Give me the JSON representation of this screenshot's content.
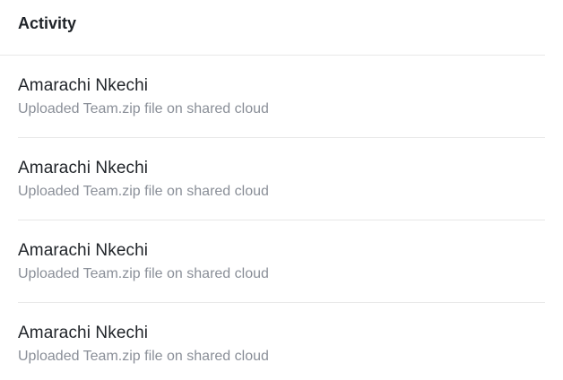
{
  "activity": {
    "title": "Activity",
    "items": [
      {
        "name": "Amarachi Nkechi",
        "description": "Uploaded Team.zip file on shared cloud"
      },
      {
        "name": "Amarachi Nkechi",
        "description": "Uploaded Team.zip file on shared cloud"
      },
      {
        "name": "Amarachi Nkechi",
        "description": "Uploaded Team.zip file on shared cloud"
      },
      {
        "name": "Amarachi Nkechi",
        "description": "Uploaded Team.zip file on shared cloud"
      }
    ]
  }
}
